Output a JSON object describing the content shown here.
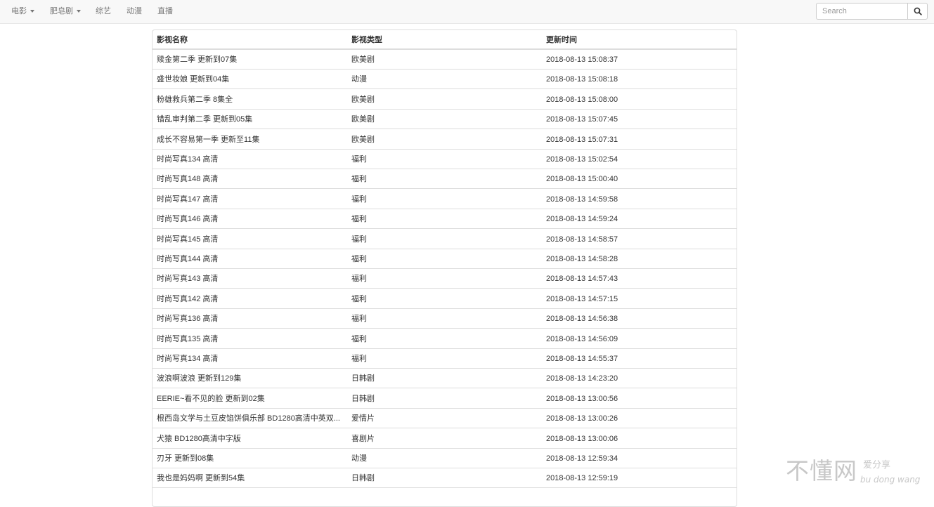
{
  "nav": {
    "items": [
      {
        "label": "电影",
        "dropdown": true
      },
      {
        "label": "肥皂剧",
        "dropdown": true
      },
      {
        "label": "综艺",
        "dropdown": false
      },
      {
        "label": "动漫",
        "dropdown": false
      },
      {
        "label": "直播",
        "dropdown": false
      }
    ],
    "search": {
      "placeholder": "Search",
      "value": "",
      "icon": "search-icon"
    }
  },
  "table": {
    "headers": [
      "影视名称",
      "影视类型",
      "更新时间"
    ],
    "rows": [
      [
        "赎金第二季 更新到07集",
        "欧美剧",
        "2018-08-13 15:08:37"
      ],
      [
        "盛世妆娘 更新到04集",
        "动漫",
        "2018-08-13 15:08:18"
      ],
      [
        "粉雄救兵第二季 8集全",
        "欧美剧",
        "2018-08-13 15:08:00"
      ],
      [
        "错乱审判第二季 更新到05集",
        "欧美剧",
        "2018-08-13 15:07:45"
      ],
      [
        "成长不容易第一季 更新至11集",
        "欧美剧",
        "2018-08-13 15:07:31"
      ],
      [
        "时尚写真134 高清",
        "福利",
        "2018-08-13 15:02:54"
      ],
      [
        "时尚写真148 高清",
        "福利",
        "2018-08-13 15:00:40"
      ],
      [
        "时尚写真147 高清",
        "福利",
        "2018-08-13 14:59:58"
      ],
      [
        "时尚写真146 高清",
        "福利",
        "2018-08-13 14:59:24"
      ],
      [
        "时尚写真145 高清",
        "福利",
        "2018-08-13 14:58:57"
      ],
      [
        "时尚写真144 高清",
        "福利",
        "2018-08-13 14:58:28"
      ],
      [
        "时尚写真143 高清",
        "福利",
        "2018-08-13 14:57:43"
      ],
      [
        "时尚写真142 高清",
        "福利",
        "2018-08-13 14:57:15"
      ],
      [
        "时尚写真136 高清",
        "福利",
        "2018-08-13 14:56:38"
      ],
      [
        "时尚写真135 高清",
        "福利",
        "2018-08-13 14:56:09"
      ],
      [
        "时尚写真134 高清",
        "福利",
        "2018-08-13 14:55:37"
      ],
      [
        "波浪啊波浪 更新到129集",
        "日韩剧",
        "2018-08-13 14:23:20"
      ],
      [
        "EERIE~看不见的脸 更新到02集",
        "日韩剧",
        "2018-08-13 13:00:56"
      ],
      [
        "根西岛文学与土豆皮馅饼俱乐部 BD1280高清中英双...",
        "爱情片",
        "2018-08-13 13:00:26"
      ],
      [
        "犬猿 BD1280高清中字版",
        "喜剧片",
        "2018-08-13 13:00:06"
      ],
      [
        "刃牙 更新到08集",
        "动漫",
        "2018-08-13 12:59:34"
      ],
      [
        "我也是妈妈啊 更新到54集",
        "日韩剧",
        "2018-08-13 12:59:19"
      ]
    ]
  },
  "watermark": {
    "main": "不懂网",
    "tagline": "爱分享",
    "pinyin": "bu dong wang"
  },
  "colors": {
    "navbar_bg": "#f8f8f8",
    "border": "#dddddd",
    "nav_text": "#777777",
    "body_text": "#333333"
  }
}
